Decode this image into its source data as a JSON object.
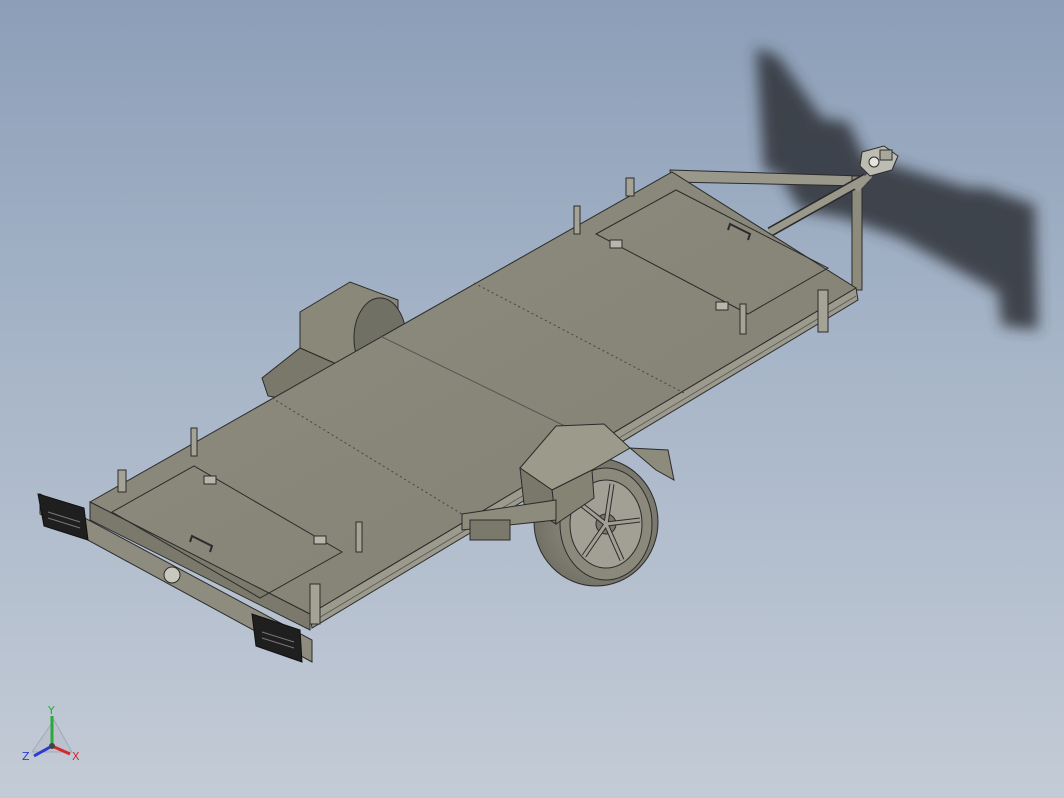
{
  "viewport": {
    "background_top": "#8c9fb8",
    "background_bottom": "#c3cbd6"
  },
  "model": {
    "body_color": "#8d8b7c",
    "edge_color": "#2b2b2b",
    "shadow_color": "#2d3038"
  },
  "triad": {
    "x_label": "X",
    "y_label": "Y",
    "z_label": "Z",
    "x_color": "#d22a2a",
    "y_color": "#2aa83a",
    "z_color": "#2a3ad2"
  }
}
